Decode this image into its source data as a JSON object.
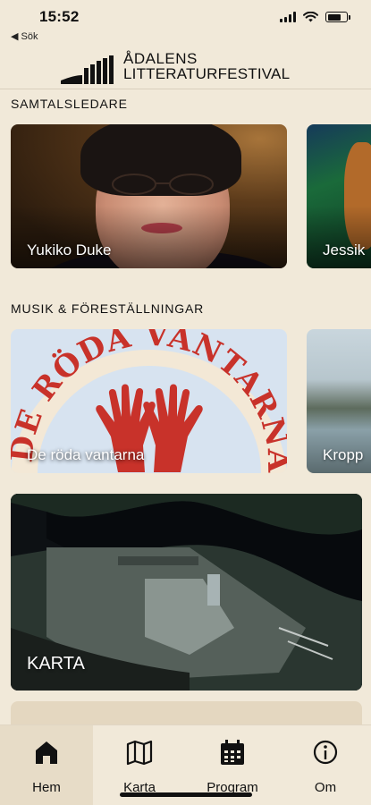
{
  "status_bar": {
    "time": "15:52",
    "back_label": "◀ Sök"
  },
  "header": {
    "logo_line1": "ÅDALENS",
    "logo_line2": "LITTERATURFESTIVAL"
  },
  "sections": {
    "moderators": {
      "title": "SAMTALSLEDARE",
      "cards": [
        {
          "name": "Yukiko Duke"
        },
        {
          "name": "Jessik"
        }
      ]
    },
    "music": {
      "title": "MUSIK & FÖRESTÄLLNINGAR",
      "cards": [
        {
          "name": "De röda vantarna",
          "poster_text": "DE RÖDA VANTARNA"
        },
        {
          "name": "Kropp"
        }
      ]
    },
    "map": {
      "label": "KARTA"
    }
  },
  "tabs": [
    {
      "label": "Hem",
      "icon": "home-icon",
      "active": true
    },
    {
      "label": "Karta",
      "icon": "map-icon",
      "active": false
    },
    {
      "label": "Program",
      "icon": "calendar-icon",
      "active": false
    },
    {
      "label": "Om",
      "icon": "info-icon",
      "active": false
    }
  ],
  "colors": {
    "background": "#f1e9d9",
    "poster_red": "#c8322a",
    "poster_blue": "#d7e3f0",
    "active_tab": "#e7dcc7"
  }
}
